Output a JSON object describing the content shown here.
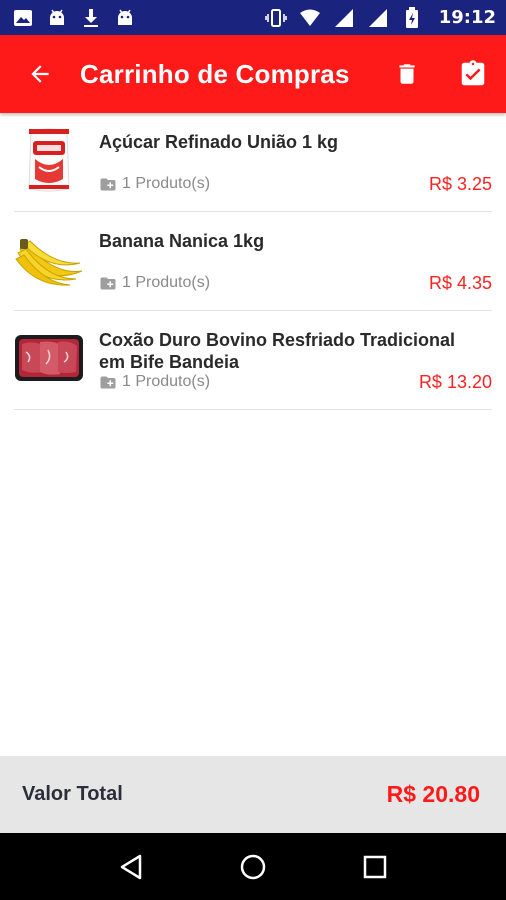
{
  "status_bar": {
    "time": "19:12",
    "left_icons": [
      "image-icon",
      "android-icon",
      "download-icon",
      "android-icon"
    ],
    "right_icons": [
      "vibrate-icon",
      "wifi-icon",
      "signal-icon",
      "signal-icon",
      "battery-icon"
    ]
  },
  "app_bar": {
    "title": "Carrinho de Compras",
    "background": "#ff1a1a",
    "icons": {
      "back": "arrow-back-icon",
      "delete": "trash-icon",
      "confirm": "clipboard-check-icon"
    }
  },
  "items": [
    {
      "name": "Açúcar Refinado União 1 kg",
      "quantity": "1 Produto(s)",
      "price": "R$ 3.25",
      "image": "sugar-bag-image"
    },
    {
      "name": "Banana Nanica 1kg",
      "quantity": "1 Produto(s)",
      "price": "R$ 4.35",
      "image": "banana-image"
    },
    {
      "name": "Coxão Duro Bovino Resfriado Tradicional em Bife Bandeia",
      "quantity": "1 Produto(s)",
      "price": "R$ 13.20",
      "image": "meat-tray-image"
    }
  ],
  "total": {
    "label": "Valor Total",
    "value": "R$ 20.80"
  },
  "colors": {
    "accent": "#ff1a1a",
    "status_bar": "#1a237e",
    "price": "#ff2222",
    "footer": "#e6e6e6"
  }
}
